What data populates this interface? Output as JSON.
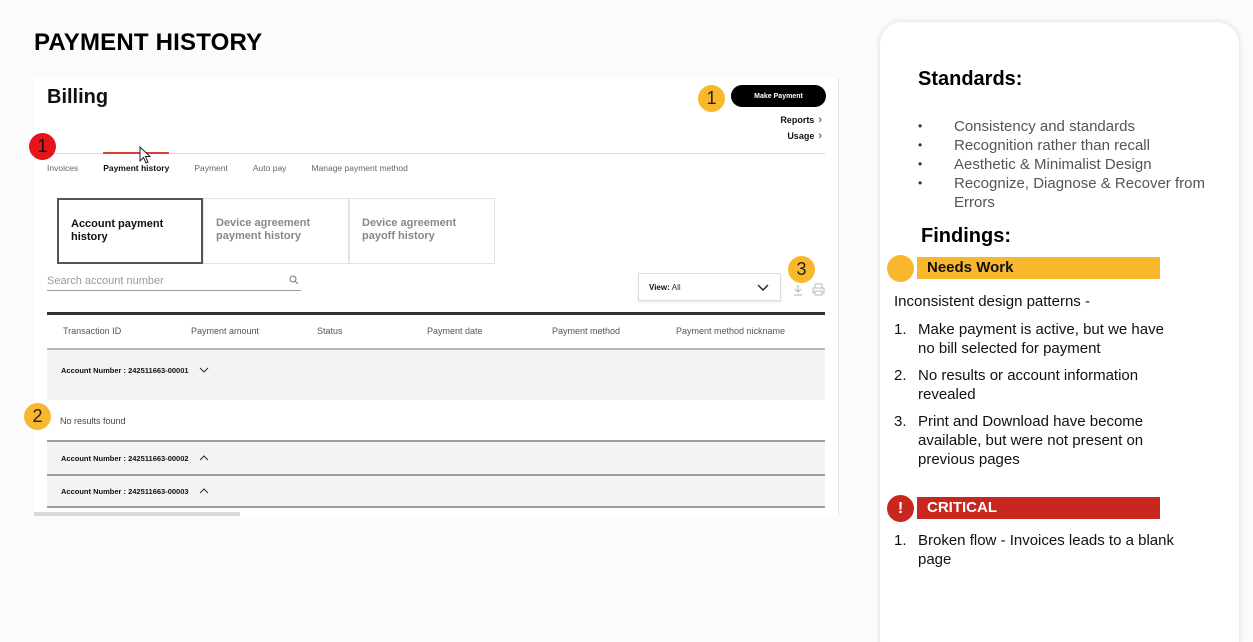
{
  "heading": "PAYMENT HISTORY",
  "screenshot": {
    "title": "Billing",
    "make_payment_label": "Make Payment",
    "reports_label": "Reports",
    "usage_label": "Usage",
    "tabs": [
      "Invoices",
      "Payment history",
      "Payment",
      "Auto pay",
      "Manage payment method"
    ],
    "active_tab": "Payment history",
    "subtabs": [
      "Account payment history",
      "Device agreement payment history",
      "Device agreement payoff history"
    ],
    "active_subtab": "Account payment history",
    "search_placeholder": "Search account number",
    "view_label": "View:",
    "view_value": "All",
    "columns": [
      "Transaction ID",
      "Payment amount",
      "Status",
      "Payment date",
      "Payment method",
      "Payment method nickname"
    ],
    "accounts": [
      {
        "label": "Account Number : 242511663-00001",
        "expanded": true
      },
      {
        "label": "Account Number : 242511663-00002",
        "expanded": false
      },
      {
        "label": "Account Number : 242511663-00003",
        "expanded": false
      }
    ],
    "no_results": "No results found"
  },
  "markers": {
    "make_payment": "1",
    "no_results": "2",
    "download_print": "3",
    "tabs_critical": "1"
  },
  "standards": {
    "title": "Standards:",
    "items": [
      "Consistency and standards",
      "Recognition rather than recall",
      "Aesthetic & Minimalist Design",
      "Recognize, Diagnose & Recover from Errors"
    ]
  },
  "findings": {
    "title": "Findings:",
    "needs_work": {
      "label": "Needs Work",
      "intro": "Inconsistent design patterns -",
      "items": [
        {
          "num": "1.",
          "text": "Make payment is active, but we have no bill selected for payment"
        },
        {
          "num": "2.",
          "text": "No results or account information revealed"
        },
        {
          "num": "3.",
          "text": "Print and Download have become available, but were not present on previous pages"
        }
      ]
    },
    "critical": {
      "icon": "!",
      "label": "CRITICAL",
      "items": [
        {
          "num": "1.",
          "text": "Broken flow - Invoices leads to a blank page"
        }
      ]
    }
  },
  "colors": {
    "needs_work": "#f9b72e",
    "critical": "#c8261f",
    "marker_red": "#e8141c",
    "active_tab_underline": "#d6422f"
  }
}
